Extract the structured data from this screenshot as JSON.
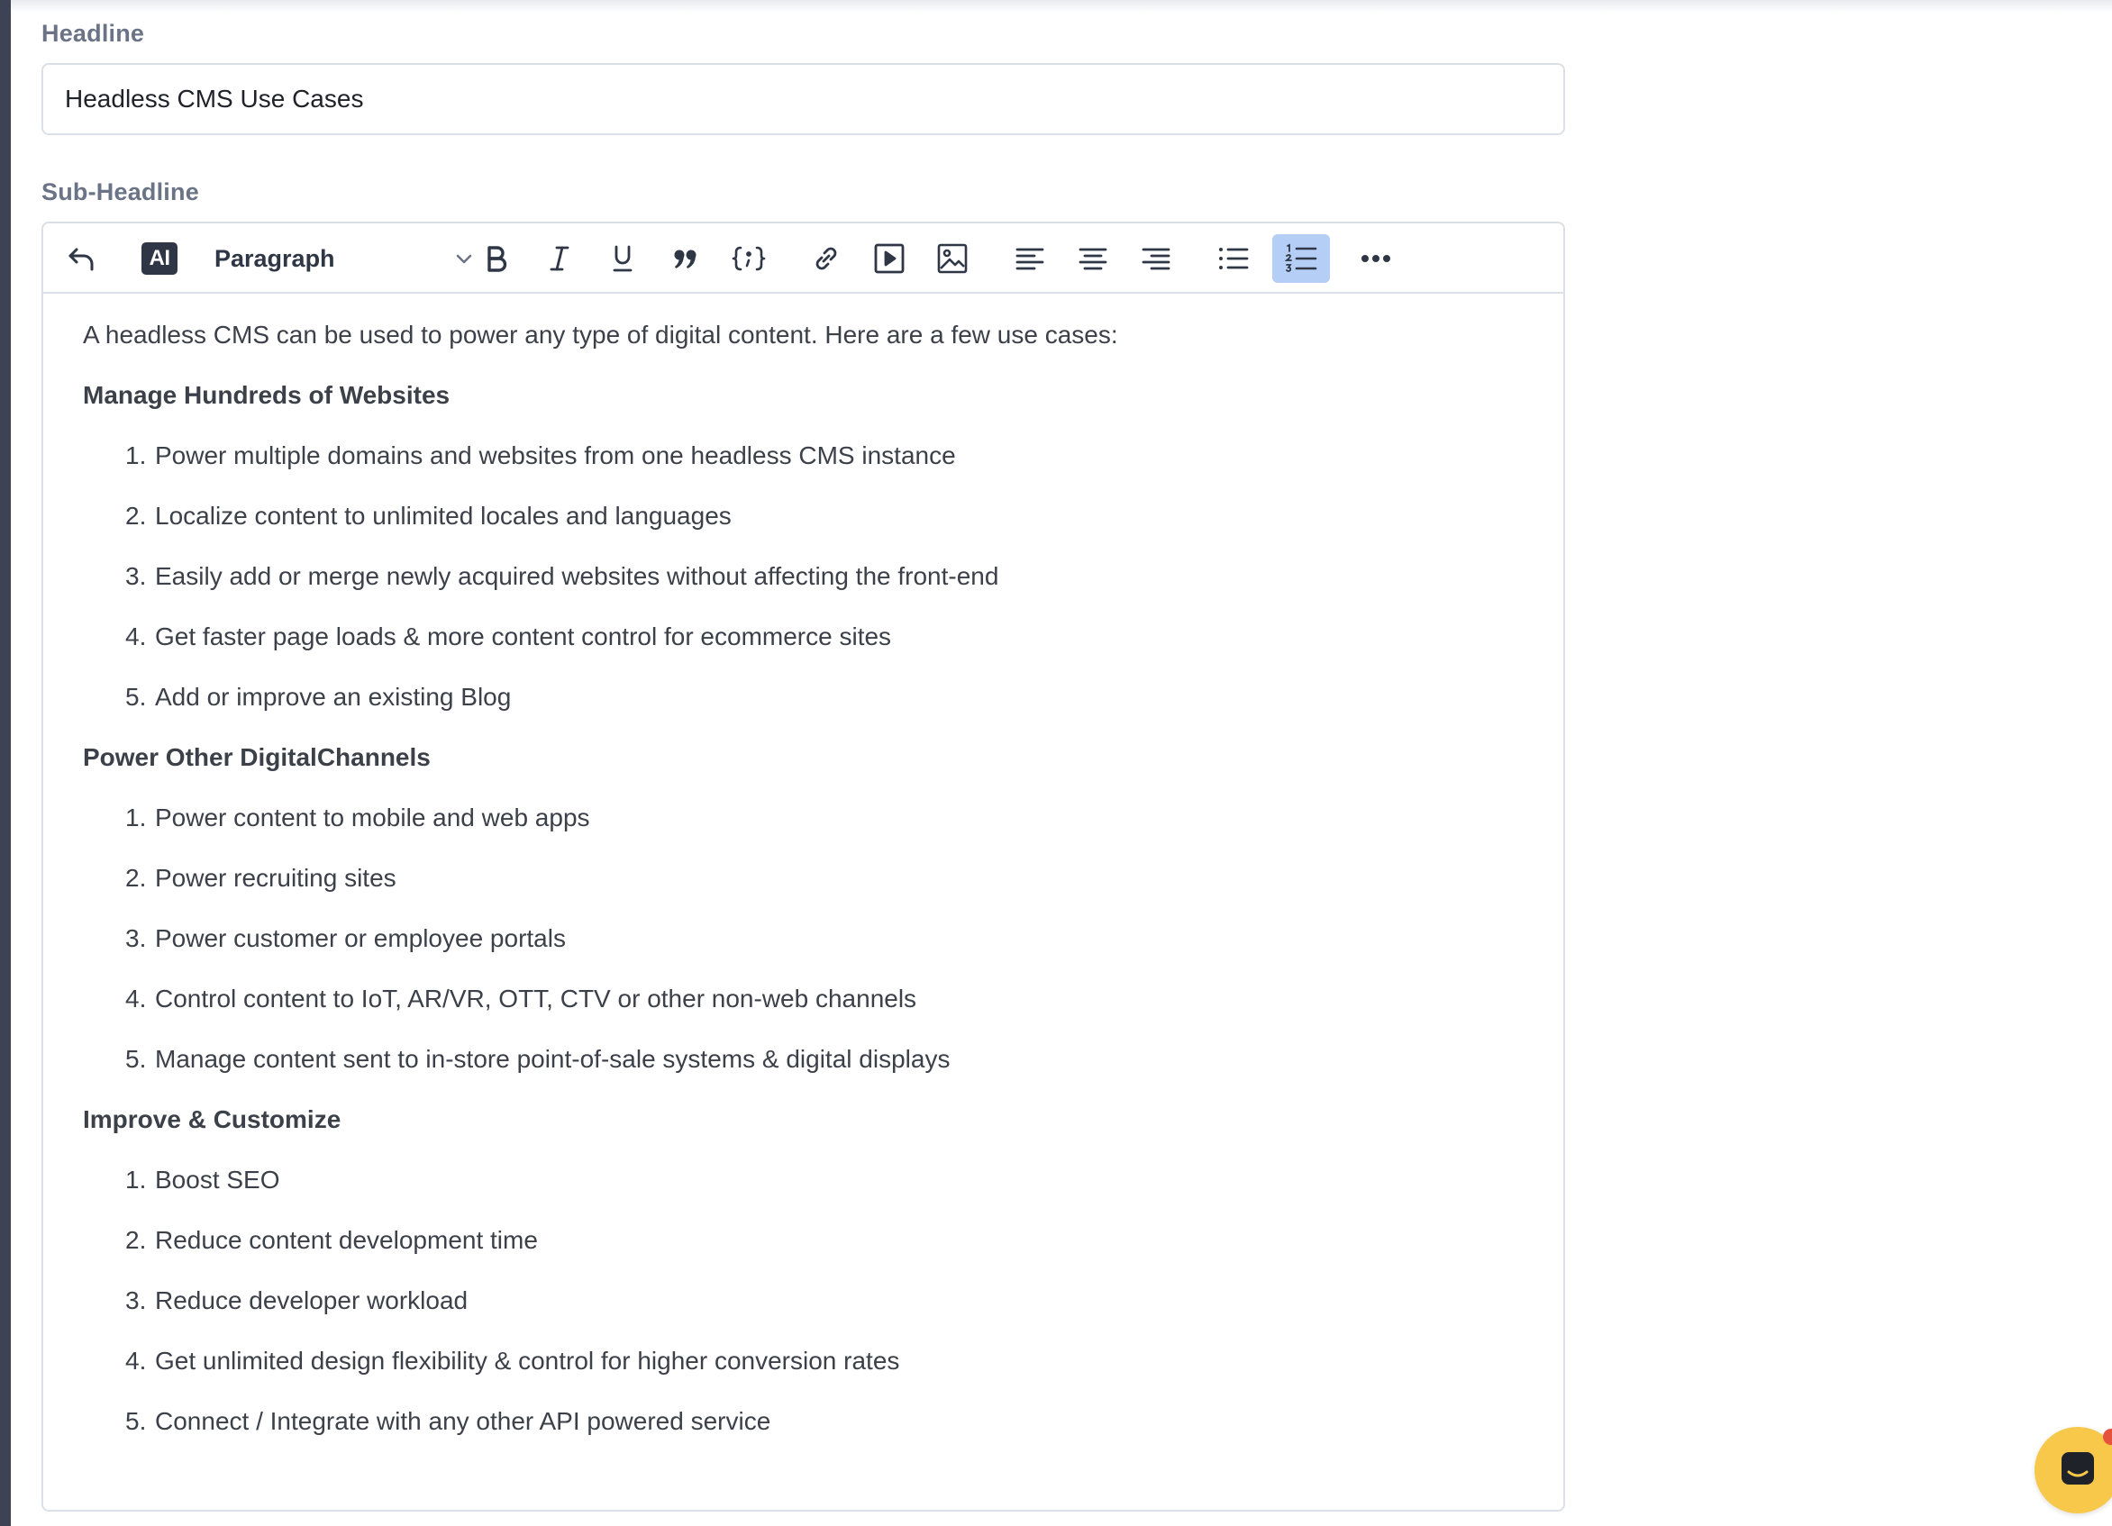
{
  "headline": {
    "label": "Headline",
    "value": "Headless CMS Use Cases"
  },
  "subheadline": {
    "label": "Sub-Headline"
  },
  "toolbar": {
    "ai_label": "AI",
    "block_format": "Paragraph",
    "active_tool": "numbered-list"
  },
  "content": {
    "intro": "A headless CMS can be used to power any type of digital content. Here are a few use cases:",
    "sections": [
      {
        "heading": "Manage Hundreds of Websites",
        "items": [
          "Power multiple domains and websites from one headless CMS instance",
          "Localize content to unlimited locales and languages",
          "Easily add or merge newly acquired websites without affecting the front-end",
          "Get faster page loads & more content control for ecommerce sites",
          "Add or improve an existing Blog"
        ]
      },
      {
        "heading": "Power Other DigitalChannels",
        "items": [
          "Power content to mobile and web apps",
          "Power recruiting sites",
          "Power customer or employee portals",
          "Control content to IoT, AR/VR, OTT, CTV or other non-web channels",
          "Manage content sent to in-store point-of-sale systems & digital displays"
        ]
      },
      {
        "heading": "Improve & Customize",
        "items": [
          "Boost SEO",
          "Reduce content development time",
          "Reduce developer workload",
          "Get unlimited design flexibility & control for higher conversion rates",
          "Connect / Integrate with any other API powered service"
        ]
      }
    ]
  },
  "colors": {
    "active_tool_bg": "#b5cef6",
    "chat_launcher": "#f7c84a",
    "left_rail": "#3d4354"
  }
}
